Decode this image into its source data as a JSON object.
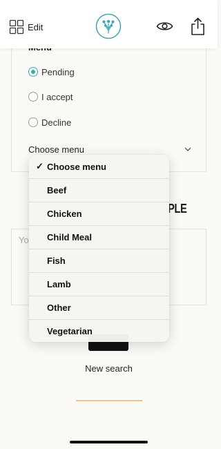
{
  "header": {
    "edit_label": "Edit",
    "icons": {
      "edit": "grid-edit-icon",
      "logo": "flower-logo",
      "preview": "eye-icon",
      "share": "share-icon"
    },
    "brand_color": "#3aa7b2"
  },
  "form": {
    "heading": "Menu",
    "options": [
      {
        "label": "Pending",
        "checked": true
      },
      {
        "label": "I accept",
        "checked": false
      },
      {
        "label": "Decline",
        "checked": false
      }
    ],
    "select": {
      "selected": "Choose menu"
    }
  },
  "background": {
    "partial_title": "PLE",
    "textarea_placeholder": "You",
    "new_search": "New search"
  },
  "dropdown": {
    "selected_index": 0,
    "check_mark": "✓",
    "items": [
      "Choose menu",
      "Beef",
      "Chicken",
      "Child Meal",
      "Fish",
      "Lamb",
      "Other",
      "Vegetarian"
    ]
  }
}
